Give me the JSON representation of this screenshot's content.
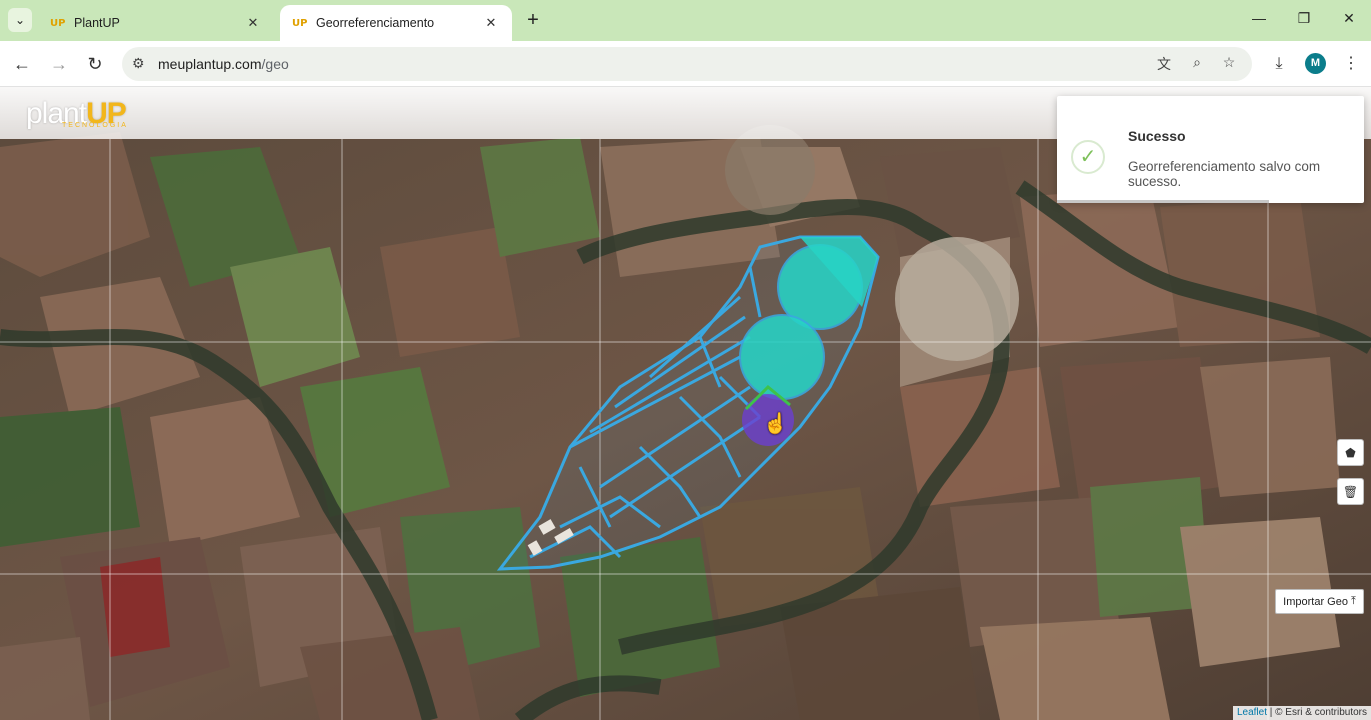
{
  "browser": {
    "tabs": [
      {
        "label": "PlantUP",
        "favicon": "UP"
      },
      {
        "label": "Georreferenciamento",
        "favicon": "UP"
      }
    ],
    "url_domain": "meuplantup.com",
    "url_path": "/geo",
    "avatar_letter": "M"
  },
  "app": {
    "logo_text_a": "plant",
    "logo_text_b": "UP",
    "logo_sub": "TECNOLOGIA"
  },
  "toast": {
    "title": "Sucesso",
    "message": "Georreferenciamento salvo com sucesso."
  },
  "map": {
    "import_label": "Importar Geo",
    "attribution_link": "Leaflet",
    "attribution_text": "| © Esri & contributors",
    "colors": {
      "polygon_stroke": "#3aa8e0",
      "pivot_fill": "#27d3c6",
      "selected_fill": "#6b3fd0"
    }
  }
}
